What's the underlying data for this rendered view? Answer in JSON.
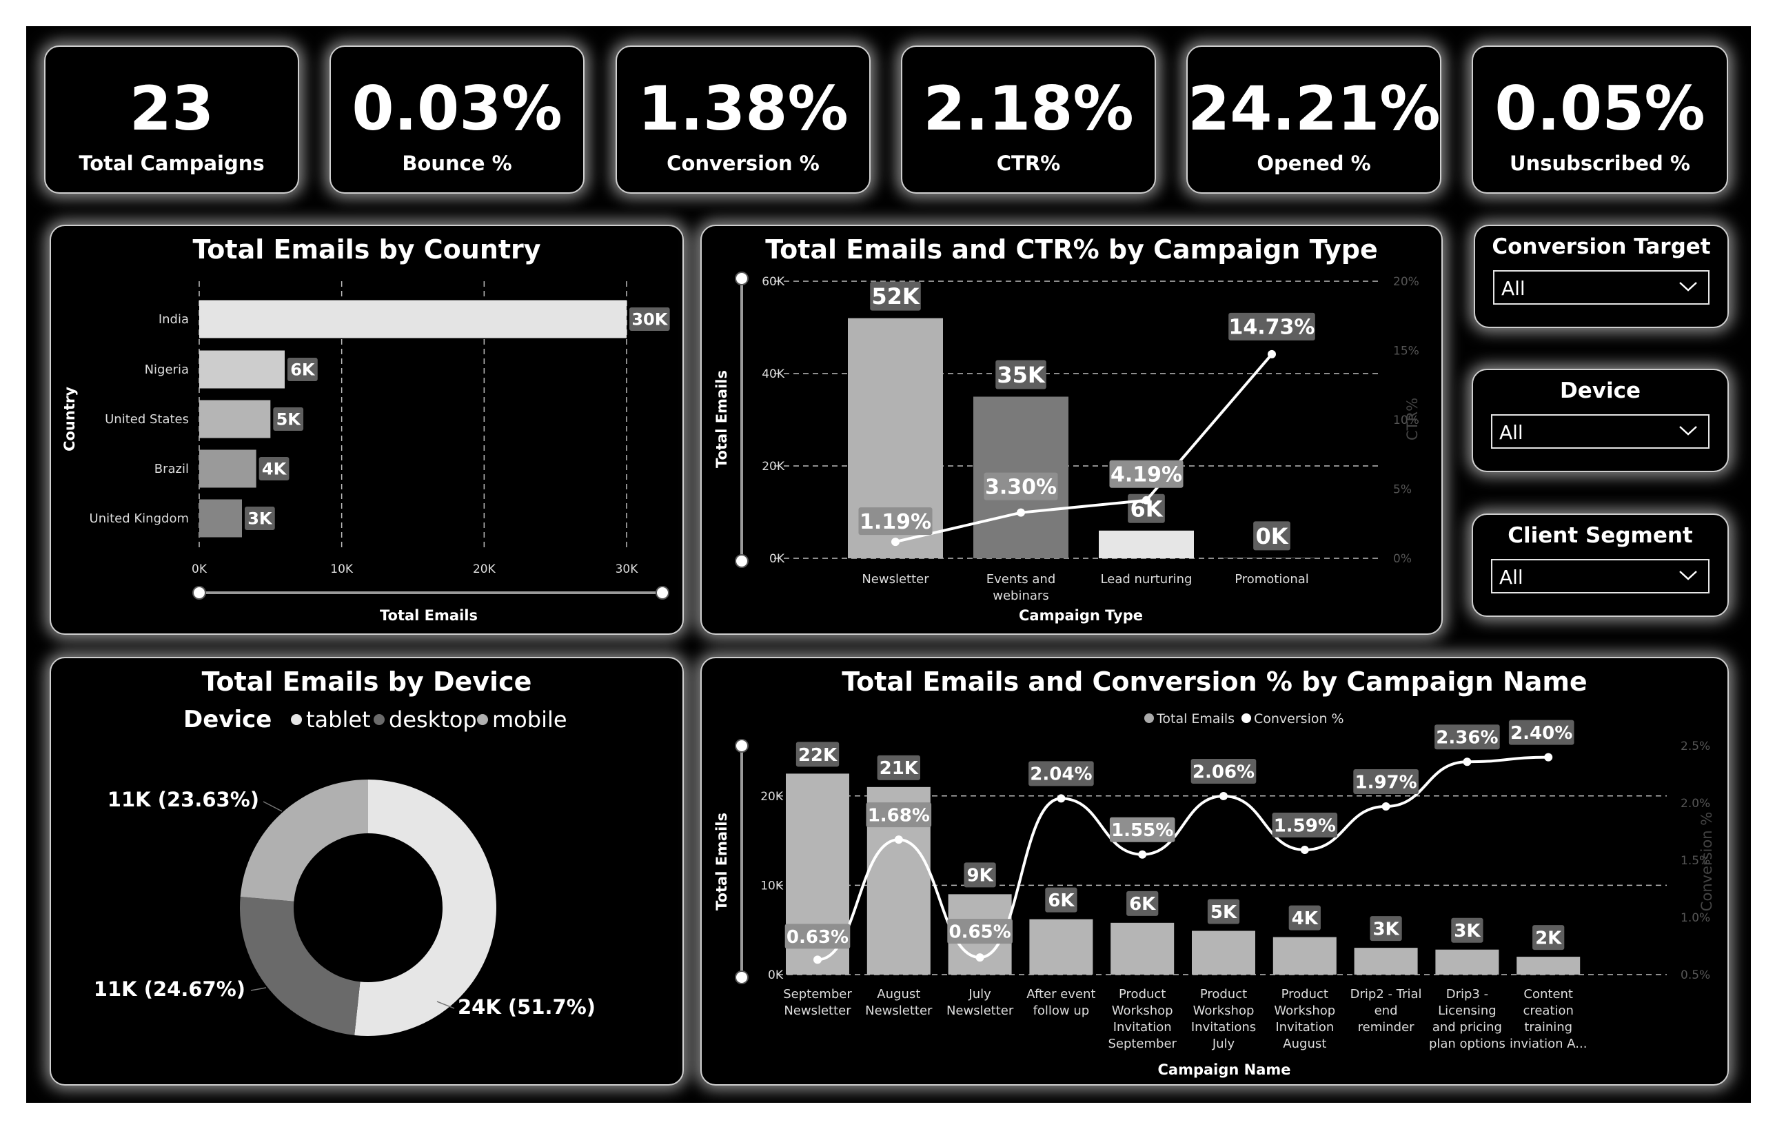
{
  "kpis": [
    {
      "value": "23",
      "label": "Total Campaigns"
    },
    {
      "value": "0.03%",
      "label": "Bounce %"
    },
    {
      "value": "1.38%",
      "label": "Conversion %"
    },
    {
      "value": "2.18%",
      "label": "CTR%"
    },
    {
      "value": "24.21%",
      "label": "Opened %"
    },
    {
      "value": "0.05%",
      "label": "Unsubscribed %"
    }
  ],
  "slicers": [
    {
      "title": "Conversion Target",
      "value": "All"
    },
    {
      "title": "Device",
      "value": "All"
    },
    {
      "title": "Client Segment",
      "value": "All"
    }
  ],
  "colors": {
    "background": "#000000",
    "border": "#cfcfcf",
    "text": "#ffffff",
    "label_box": "#5f5f5f",
    "line": "#ffffff"
  },
  "icons": {
    "dropdown": "chevron-down-icon",
    "legend_marker": "filled-circle-icon"
  },
  "chart_data": [
    {
      "type": "bar",
      "orientation": "horizontal",
      "title": "Total Emails by Country",
      "xlabel": "Total Emails",
      "ylabel": "Country",
      "categories": [
        "India",
        "Nigeria",
        "United States",
        "Brazil",
        "United Kingdom"
      ],
      "values": [
        30000,
        6000,
        5000,
        4000,
        3000
      ],
      "data_labels": [
        "30K",
        "6K",
        "5K",
        "4K",
        "3K"
      ],
      "bar_colors": [
        "#e4e4e4",
        "#cdcdcd",
        "#b5b5b5",
        "#9a9a9a",
        "#858585"
      ],
      "x_ticks": [
        "0K",
        "10K",
        "20K",
        "30K"
      ],
      "xlim": [
        0,
        30000
      ],
      "grid": "vertical dashed"
    },
    {
      "type": "bar",
      "title": "Total Emails and CTR% by Campaign Type",
      "xlabel": "Campaign Type",
      "ylabel": "Total Emails",
      "y2label": "CTR%",
      "categories": [
        "Newsletter",
        "Events and webinars",
        "Lead nurturing",
        "Promotional"
      ],
      "series": [
        {
          "name": "Total Emails",
          "kind": "bar",
          "values": [
            52000,
            35000,
            6000,
            100
          ],
          "data_labels": [
            "52K",
            "35K",
            "6K",
            "0K"
          ]
        },
        {
          "name": "CTR%",
          "kind": "line",
          "values": [
            1.19,
            3.3,
            4.19,
            14.73
          ],
          "data_labels": [
            "1.19%",
            "3.30%",
            "4.19%",
            "14.73%"
          ]
        }
      ],
      "bar_colors": [
        "#b2b2b2",
        "#7a7a7a",
        "#e6e6e6",
        "#9a9a9a"
      ],
      "y_ticks": [
        "0K",
        "20K",
        "40K",
        "60K"
      ],
      "ylim": [
        0,
        60000
      ],
      "y2_ticks": [
        "0%",
        "5%",
        "10%",
        "15%",
        "20%"
      ],
      "y2lim": [
        0,
        20
      ],
      "grid": "horizontal dashed"
    },
    {
      "type": "pie",
      "donut": true,
      "title": "Total Emails by Device",
      "legend_title": "Device",
      "legend": [
        "tablet",
        "desktop",
        "mobile"
      ],
      "slices": [
        {
          "name": "tablet",
          "value": 24000,
          "percent": 51.7,
          "label": "24K (51.7%)",
          "color": "#e6e6e6"
        },
        {
          "name": "desktop",
          "value": 11000,
          "percent": 24.67,
          "label": "11K (24.67%)",
          "color": "#6a6a6a"
        },
        {
          "name": "mobile",
          "value": 11000,
          "percent": 23.63,
          "label": "11K (23.63%)",
          "color": "#b0b0b0"
        }
      ]
    },
    {
      "type": "bar",
      "title": "Total Emails and Conversion % by Campaign Name",
      "xlabel": "Campaign Name",
      "ylabel": "Total Emails",
      "y2label": "Conversion %",
      "legend": [
        "Total Emails",
        "Conversion %"
      ],
      "categories": [
        [
          "September",
          "Newsletter"
        ],
        [
          "August",
          "Newsletter"
        ],
        [
          "July",
          "Newsletter"
        ],
        [
          "After event",
          "follow up"
        ],
        [
          "Product",
          "Workshop",
          "Invitation",
          "September"
        ],
        [
          "Product",
          "Workshop",
          "Invitations",
          "July"
        ],
        [
          "Product",
          "Workshop",
          "Invitation",
          "August"
        ],
        [
          "Drip2 - Trial",
          "end",
          "reminder"
        ],
        [
          "Drip3 -",
          "Licensing",
          "and pricing",
          "plan options"
        ],
        [
          "Content",
          "creation",
          "training",
          "inviation A..."
        ]
      ],
      "series": [
        {
          "name": "Total Emails",
          "kind": "bar",
          "values": [
            22500,
            21000,
            9000,
            6200,
            5800,
            4900,
            4200,
            3000,
            2800,
            2000
          ],
          "data_labels": [
            "22K",
            "21K",
            "9K",
            "6K",
            "6K",
            "5K",
            "4K",
            "3K",
            "3K",
            "2K"
          ]
        },
        {
          "name": "Conversion %",
          "kind": "line",
          "values": [
            0.63,
            1.68,
            0.65,
            2.04,
            1.55,
            2.06,
            1.59,
            1.97,
            2.36,
            2.4
          ],
          "data_labels": [
            "0.63%",
            "1.68%",
            "0.65%",
            "2.04%",
            "1.55%",
            "2.06%",
            "1.59%",
            "1.97%",
            "2.36%",
            "2.40%"
          ]
        }
      ],
      "y_ticks": [
        "0K",
        "10K",
        "20K"
      ],
      "ylim": [
        0,
        25000
      ],
      "y2_ticks": [
        "0.5%",
        "1.0%",
        "1.5%",
        "2.0%",
        "2.5%"
      ],
      "y2lim": [
        0.5,
        2.5
      ],
      "grid": "horizontal dashed"
    }
  ]
}
